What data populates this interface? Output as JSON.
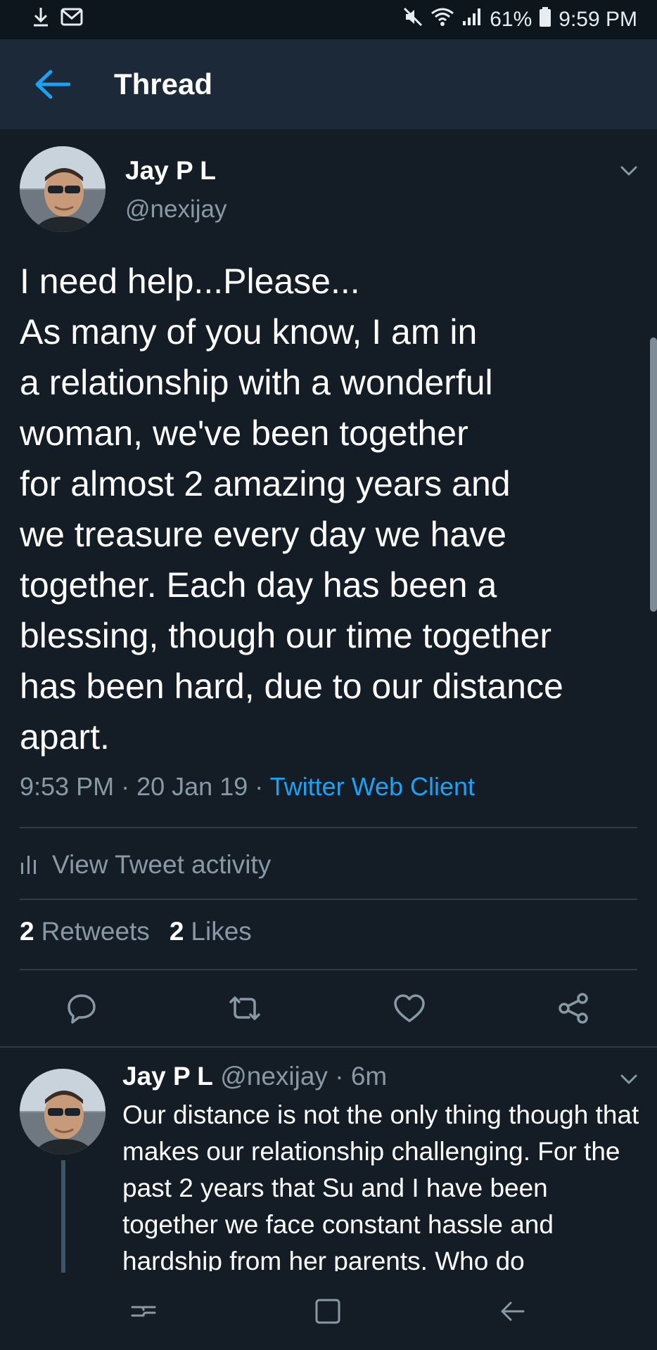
{
  "status_bar": {
    "battery": "61%",
    "time": "9:59 PM",
    "icons": [
      "download-icon",
      "gmail-icon",
      "mute-icon",
      "wifi-icon",
      "signal-icon",
      "battery-icon"
    ]
  },
  "header": {
    "title": "Thread",
    "back_icon": "back-arrow-icon"
  },
  "main_tweet": {
    "name": "Jay P L",
    "handle": "@nexijay",
    "text": "I need help...Please...\nAs many of you know, I am in\na relationship with a wonderful\nwoman, we've been together\nfor almost 2 amazing years and\nwe treasure every day we have\ntogether. Each day has been a\nblessing, though our time together\nhas been hard, due to our distance\napart.",
    "time": "9:53 PM",
    "date": "20 Jan 19",
    "separator": "·",
    "source": "Twitter Web Client",
    "activity_label": "View Tweet activity",
    "retweets_count": "2",
    "retweets_label": "Retweets",
    "likes_count": "2",
    "likes_label": "Likes",
    "actions": [
      "reply-icon",
      "retweet-icon",
      "like-icon",
      "share-icon"
    ]
  },
  "reply": {
    "name": "Jay P L",
    "handle": "@nexijay",
    "separator": "·",
    "time": "6m",
    "text": "Our distance is not the only thing though that makes our relationship challenging. For the past 2 years that Su and I have been together we face constant hassle and hardship from her parents. Who do"
  },
  "colors": {
    "background": "#141d26",
    "header": "#1c2938",
    "accent": "#1da1f2",
    "muted": "#8899a6",
    "divider": "#2f3b47"
  }
}
